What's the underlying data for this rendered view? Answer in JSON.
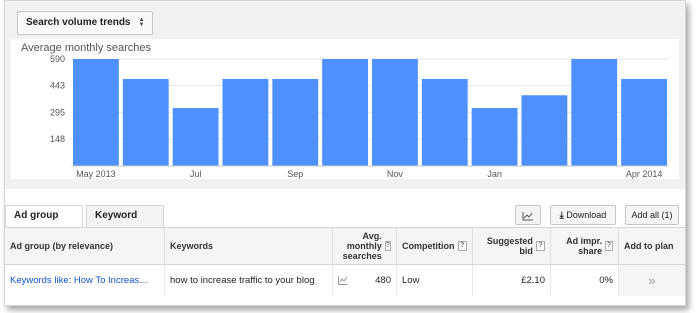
{
  "toolbar": {
    "trend_dropdown": "Search volume trends"
  },
  "chart_data": {
    "type": "bar",
    "title": "Average monthly searches",
    "categories": [
      "May 2013",
      "Jun",
      "Jul",
      "Aug",
      "Sep",
      "Oct",
      "Nov",
      "Dec",
      "Jan",
      "Feb",
      "Mar",
      "Apr 2014"
    ],
    "x_tick_labels": [
      "May 2013",
      "Jul",
      "Sep",
      "Nov",
      "Jan",
      "Apr 2014"
    ],
    "values": [
      590,
      480,
      320,
      480,
      480,
      590,
      590,
      480,
      320,
      390,
      590,
      480
    ],
    "y_ticks": [
      148,
      295,
      443,
      590
    ],
    "ylim": [
      0,
      600
    ],
    "bar_color": "#4d90fe",
    "grid": true
  },
  "tabs": [
    {
      "label": "Ad group ideas",
      "active": true
    },
    {
      "label": "Keyword ideas",
      "active": false
    }
  ],
  "buttons": {
    "chart_icon": "chart-icon",
    "download": "Download",
    "add_all": "Add all (1)"
  },
  "table": {
    "headers": {
      "ad_group": "Ad group (by relevance)",
      "keywords": "Keywords",
      "avg_searches": "Avg. monthly searches",
      "competition": "Competition",
      "suggested_bid": "Suggested bid",
      "ad_impr_share": "Ad impr. share",
      "add_to_plan": "Add to plan"
    },
    "rows": [
      {
        "ad_group": "Keywords like: How To Increas…",
        "keywords": "how to increase traffic to your blog",
        "avg_searches": "480",
        "competition": "Low",
        "suggested_bid": "£2.10",
        "ad_impr_share": "0%",
        "add_icon": "»"
      }
    ]
  }
}
